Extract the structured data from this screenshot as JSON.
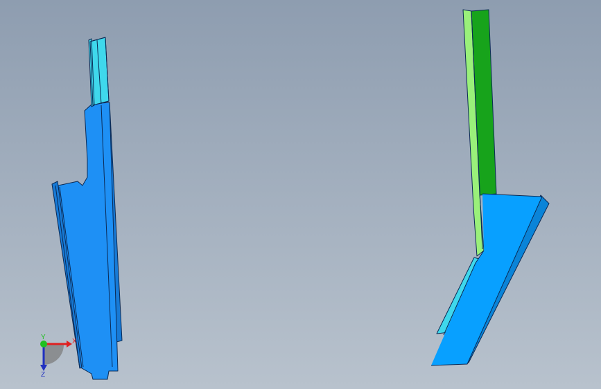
{
  "viewport": {
    "background_top": "#8e9db0",
    "background_bottom": "#b8c2cd"
  },
  "parts": {
    "left_part": {
      "body_color": "#1e90f5",
      "body_shade": "#177ad6",
      "top_color": "#3fd8ec",
      "edge_color": "#0b2a55"
    },
    "right_part": {
      "body_color": "#08a0ff",
      "body_shade": "#0a84d8",
      "upper_face_color": "#17a31b",
      "upper_side_color": "#9af07a",
      "lower_face_color": "#3fd8ec",
      "edge_color": "#0b2a55"
    }
  },
  "triad": {
    "x_label": "X",
    "y_label": "Y",
    "z_label": "Z",
    "x_color": "#e02020",
    "y_color": "#20c020",
    "z_color": "#2030c0"
  }
}
